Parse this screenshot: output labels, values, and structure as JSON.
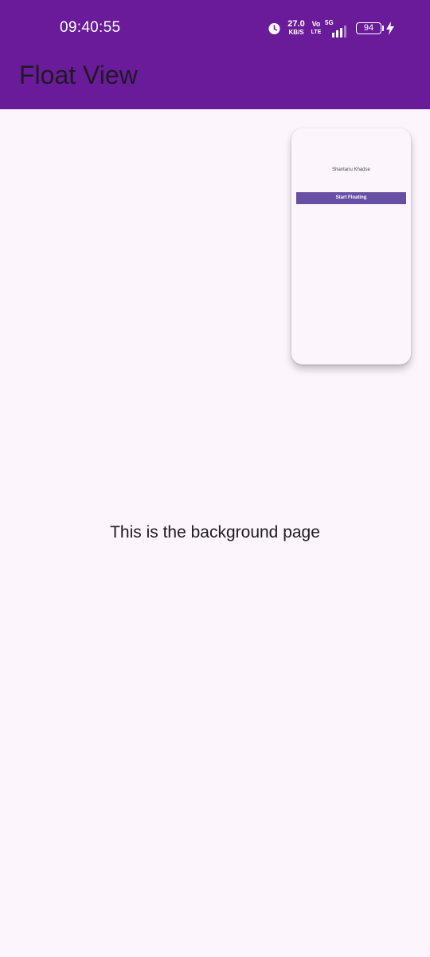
{
  "status_bar": {
    "time": "09:40:55",
    "net_speed_value": "27.0",
    "net_speed_unit": "KB/S",
    "volte_top": "Vo",
    "volte_bottom": "LTE",
    "network_type": "5G",
    "battery_level": "94",
    "icons": [
      "alarm-icon",
      "signal-icon",
      "battery-icon",
      "charging-bolt-icon"
    ]
  },
  "app_bar": {
    "title": "Float View",
    "color": "#6a1b9a"
  },
  "floating_window": {
    "name": "Shantanu Khadse",
    "button_label": "Start Floating",
    "button_color": "#6750a4"
  },
  "background_page": {
    "text": "This is the background page"
  }
}
